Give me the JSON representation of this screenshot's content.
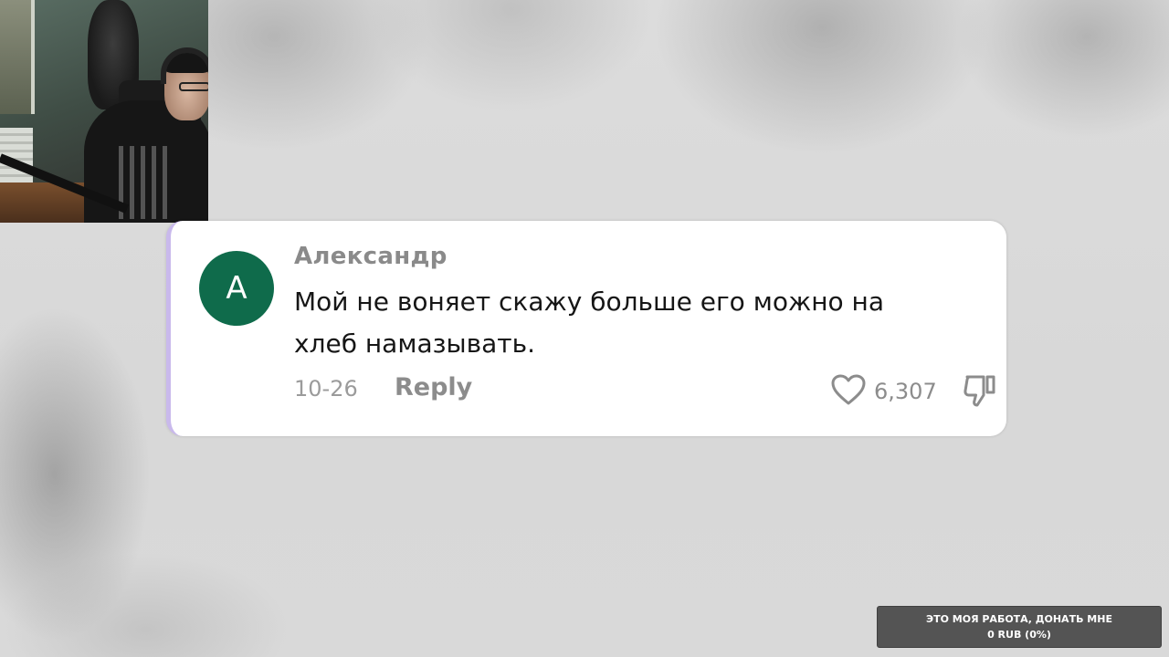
{
  "webcam": {
    "icon": "webcam-feed"
  },
  "comment": {
    "avatar_letter": "A",
    "avatar_color": "#0f6b4b",
    "accent_border_color": "#c9b9ec",
    "author": "Александр",
    "text_lines": [
      "Мой не воняет скажу больше его можно на",
      "хлеб намазывать."
    ],
    "date": "10-26",
    "reply_label": "Reply",
    "like_icon": "heart-icon",
    "like_count": "6,307",
    "dislike_icon": "thumbs-down-icon"
  },
  "donation": {
    "line1": "ЭТО МОЯ РАБОТА, ДОНАТЬ МНЕ",
    "line2": "0 RUB (0%)",
    "progress_percent": 0
  }
}
